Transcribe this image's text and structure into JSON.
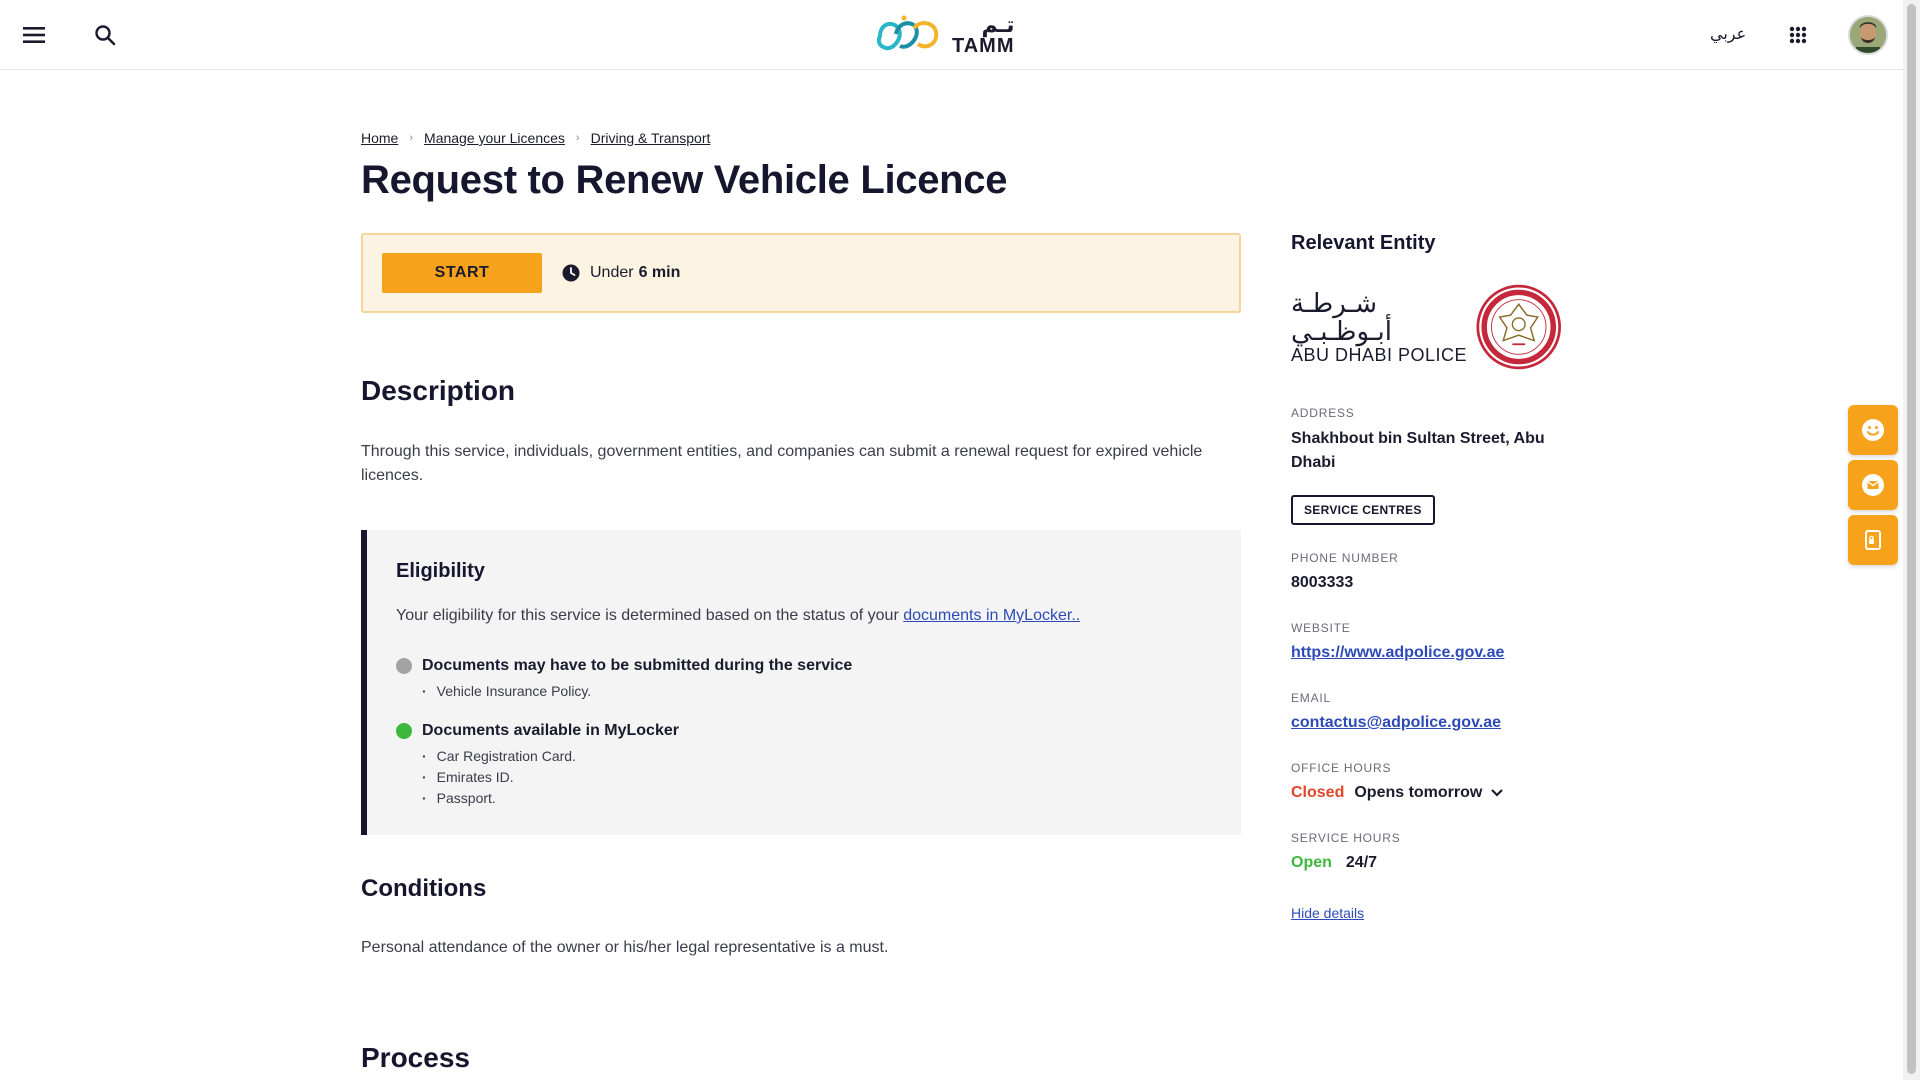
{
  "header": {
    "logo_ar": "تـم",
    "logo_en": "TAMM",
    "language_link": "عربي"
  },
  "breadcrumb": {
    "items": [
      "Home",
      "Manage your Licences",
      "Driving & Transport"
    ]
  },
  "page_title": "Request to Renew Vehicle Licence",
  "start_panel": {
    "start_label": "START",
    "duration_prefix": "Under",
    "duration_value": "6 min"
  },
  "description": {
    "heading": "Description",
    "text": "Through this service, individuals, government entities, and companies can submit a renewal request for expired vehicle licences."
  },
  "eligibility": {
    "heading": "Eligibility",
    "text_prefix": "Your eligibility for this service is determined based on the status of your",
    "link_text": "documents in MyLocker..",
    "groups": [
      {
        "title": "Documents may have to be submitted during the service",
        "status_color": "#a3a3a3",
        "items": [
          "Vehicle Insurance Policy."
        ]
      },
      {
        "title": "Documents available in MyLocker",
        "status_color": "#3db83d",
        "items": [
          "Car Registration Card.",
          "Emirates ID.",
          "Passport."
        ]
      }
    ]
  },
  "conditions": {
    "heading": "Conditions",
    "text": "Personal attendance of the owner or his/her legal representative is a must."
  },
  "process": {
    "heading": "Process"
  },
  "entity": {
    "heading": "Relevant Entity",
    "logo_ar": "شـرطـة أبـوظـبـي",
    "logo_en": "ABU DHABI POLICE",
    "address_label": "ADDRESS",
    "address": "Shakhbout bin Sultan Street, Abu Dhabi",
    "service_centres_label": "SERVICE CENTRES",
    "phone_label": "PHONE NUMBER",
    "phone": "8003333",
    "website_label": "WEBSITE",
    "website": "https://www.adpolice.gov.ae",
    "email_label": "EMAIL",
    "email": "contactus@adpolice.gov.ae",
    "office_hours_label": "OFFICE HOURS",
    "office_status": "Closed",
    "office_next": "Opens tomorrow",
    "service_hours_label": "SERVICE HOURS",
    "service_status": "Open",
    "service_hours": "24/7",
    "hide_details": "Hide details"
  },
  "floating_actions": [
    {
      "icon": "smiley-icon"
    },
    {
      "icon": "mail-icon"
    },
    {
      "icon": "locker-icon"
    }
  ],
  "colors": {
    "accent": "#f6a21b",
    "accent_bg": "#fdf3e3",
    "dark": "#16162e",
    "link": "#2d4ab8",
    "closed": "#e0462a",
    "open": "#3db83d"
  }
}
